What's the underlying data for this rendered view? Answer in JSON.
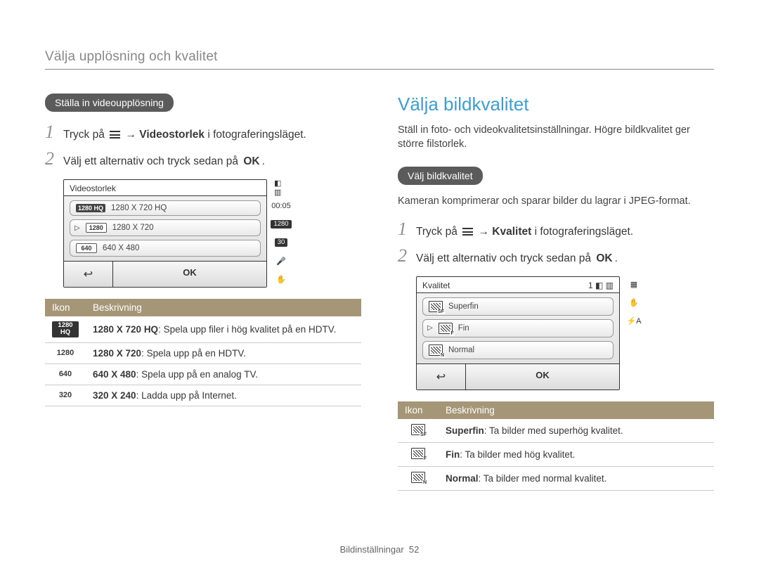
{
  "header": {
    "title": "Välja upplösning och kvalitet"
  },
  "left": {
    "pill": "Ställa in videoupplösning",
    "step1_prefix": "Tryck på ",
    "step1_arrow": "→",
    "step1_bold": "Videostorlek",
    "step1_suffix": " i fotograferingsläget.",
    "step2": "Välj ett alternativ och tryck sedan på ",
    "step2_ok": "OK",
    "lcd": {
      "title": "Videostorlek",
      "rows": [
        {
          "icon": "1280 HQ",
          "label": "1280 X 720 HQ"
        },
        {
          "icon": "1280",
          "label": "1280 X 720"
        },
        {
          "icon": "640",
          "label": "640 X 480"
        }
      ],
      "back": "↩",
      "ok": "OK",
      "side_time": "00:05"
    },
    "table": {
      "h1": "Ikon",
      "h2": "Beskrivning",
      "rows": [
        {
          "icon": "1280 HQ",
          "bold": "1280 X 720 HQ",
          "rest": ": Spela upp filer i hög kvalitet på en HDTV."
        },
        {
          "icon": "1280",
          "bold": "1280 X 720",
          "rest": ": Spela upp på en HDTV."
        },
        {
          "icon": "640",
          "bold": "640 X 480",
          "rest": ": Spela upp på en analog TV."
        },
        {
          "icon": "320",
          "bold": "320 X 240",
          "rest": ": Ladda upp på Internet."
        }
      ]
    }
  },
  "right": {
    "title": "Välja bildkvalitet",
    "intro": "Ställ in foto- och videokvalitetsinställningar. Högre bildkvalitet ger större filstorlek.",
    "pill": "Välj bildkvalitet",
    "note": "Kameran komprimerar och sparar bilder du lagrar i JPEG-format.",
    "step1_prefix": "Tryck på ",
    "step1_arrow": "→",
    "step1_bold": "Kvalitet",
    "step1_suffix": " i fotograferingsläget.",
    "step2": "Välj ett alternativ och tryck sedan på ",
    "step2_ok": "OK",
    "lcd": {
      "title": "Kvalitet",
      "top_right": "1",
      "rows": [
        {
          "sub": "SF",
          "label": "Superfin"
        },
        {
          "sub": "F",
          "label": "Fin"
        },
        {
          "sub": "N",
          "label": "Normal"
        }
      ],
      "back": "↩",
      "ok": "OK"
    },
    "table": {
      "h1": "Ikon",
      "h2": "Beskrivning",
      "rows": [
        {
          "sub": "SF",
          "bold": "Superfin",
          "rest": ": Ta bilder med superhög kvalitet."
        },
        {
          "sub": "F",
          "bold": "Fin",
          "rest": ": Ta bilder med hög kvalitet."
        },
        {
          "sub": "N",
          "bold": "Normal",
          "rest": ": Ta bilder med normal kvalitet."
        }
      ]
    }
  },
  "footer": {
    "section": "Bildinställningar",
    "page": "52"
  }
}
